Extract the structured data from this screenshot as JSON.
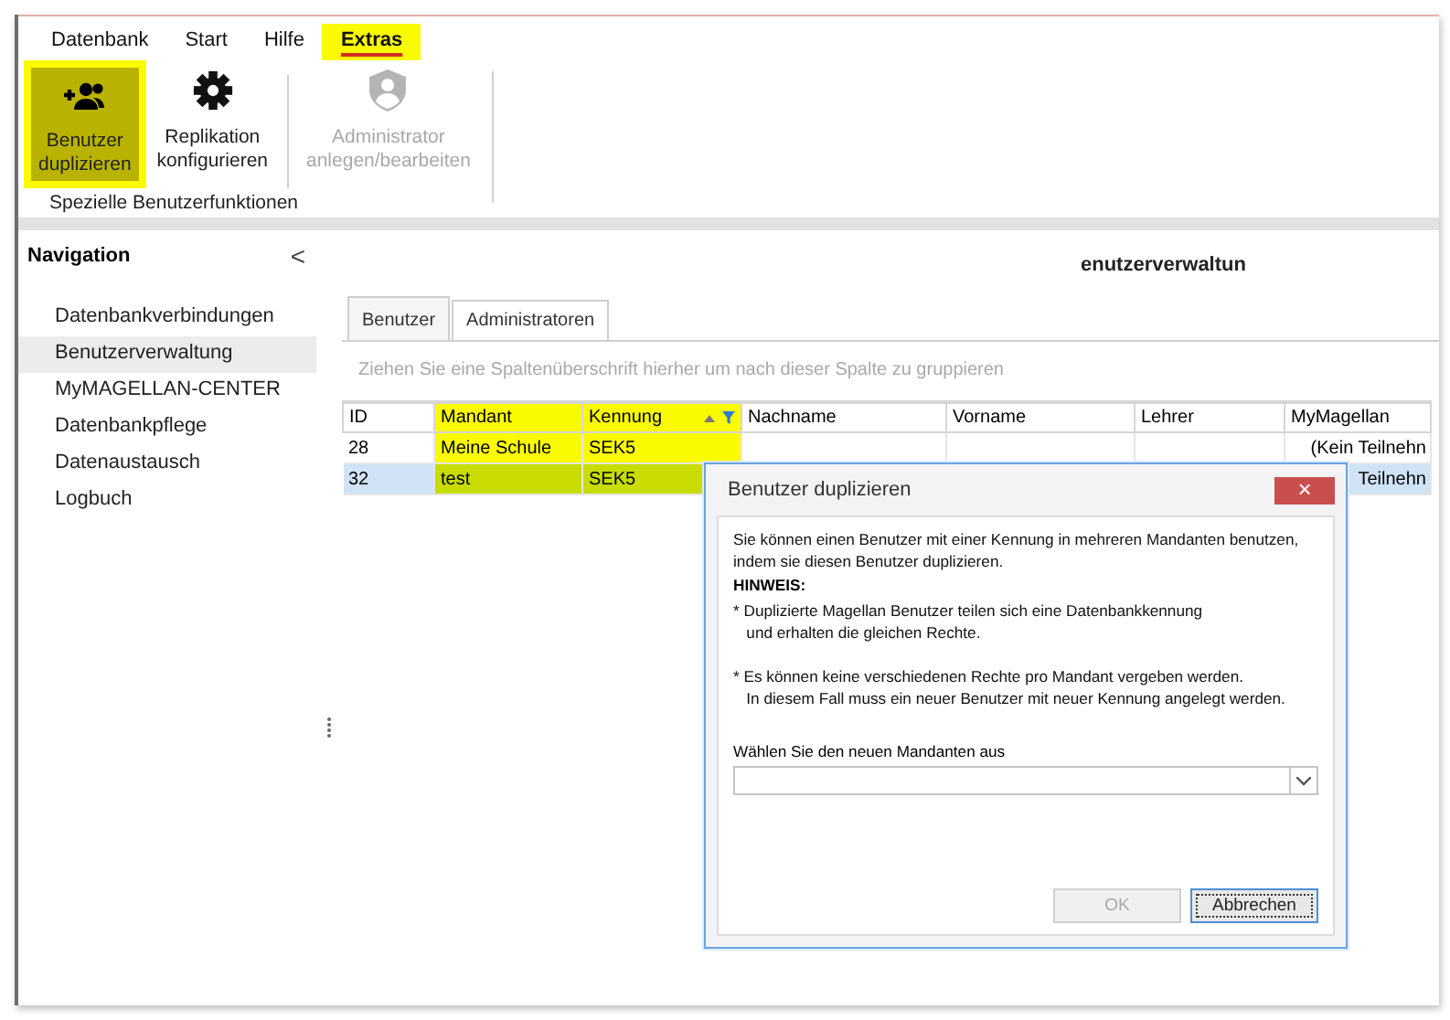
{
  "menu": [
    {
      "label": "Datenbank",
      "selected": false,
      "highlighted": false
    },
    {
      "label": "Start",
      "selected": false,
      "highlighted": false
    },
    {
      "label": "Hilfe",
      "selected": false,
      "highlighted": false
    },
    {
      "label": "Extras",
      "selected": true,
      "highlighted": true
    }
  ],
  "ribbon": {
    "groups": [
      {
        "label": "Spezielle Benutzerfunktionen",
        "buttons": [
          {
            "label": "Benutzer\nduplizieren",
            "disabled": false,
            "highlighted": true,
            "separator_after": false
          },
          {
            "label": "Replikation\nkonfigurieren",
            "disabled": false,
            "highlighted": false,
            "separator_after": true
          },
          {
            "label": "Administrator\nanlegen/bearbeiten",
            "disabled": true,
            "highlighted": false,
            "separator_after": false
          }
        ]
      }
    ]
  },
  "navigation": {
    "title": "Navigation",
    "collapse": "<",
    "items": [
      {
        "label": "Datenbankverbindungen",
        "selected": false
      },
      {
        "label": "Benutzerverwaltung",
        "selected": true
      },
      {
        "label": "MyMAGELLAN-CENTER",
        "selected": false
      },
      {
        "label": "Datenbankpflege",
        "selected": false
      },
      {
        "label": "Datenaustausch",
        "selected": false
      },
      {
        "label": "Logbuch",
        "selected": false
      }
    ]
  },
  "content": {
    "title": "enutzerverwaltun",
    "tabs": [
      {
        "label": "Benutzer",
        "selected": true
      },
      {
        "label": "Administratoren",
        "selected": false
      }
    ],
    "grid": {
      "group_hint": "Ziehen Sie eine Spaltenüberschrift hierher um nach dieser Spalte zu gruppieren",
      "columns": [
        {
          "label": "ID",
          "highlighted": false,
          "sorted": false,
          "filter": false
        },
        {
          "label": "Mandant",
          "highlighted": true,
          "sorted": false,
          "filter": false
        },
        {
          "label": "Kennung",
          "highlighted": true,
          "sorted": true,
          "filter": true
        },
        {
          "label": "Nachname",
          "highlighted": false,
          "sorted": false,
          "filter": false
        },
        {
          "label": "Vorname",
          "highlighted": false,
          "sorted": false,
          "filter": false
        },
        {
          "label": "Lehrer",
          "highlighted": false,
          "sorted": false,
          "filter": false
        },
        {
          "label": "MyMagellan",
          "highlighted": false,
          "sorted": false,
          "filter": false
        }
      ],
      "rows": [
        {
          "selected": false,
          "cells": [
            "28",
            "Meine Schule",
            "SEK5",
            null,
            null,
            null,
            "(Kein Teilnehn"
          ]
        },
        {
          "selected": true,
          "cells": [
            "32",
            "test",
            "SEK5",
            null,
            null,
            null,
            "Teilnehn"
          ]
        }
      ]
    }
  },
  "dialog": {
    "title": "Benutzer duplizieren",
    "close": "×",
    "intro": "Sie können einen Benutzer mit einer Kennung in mehreren Mandanten benutzen,\nindem sie diesen Benutzer duplizieren.",
    "note_heading": "HINWEIS:",
    "notes": [
      "* Duplizierte Magellan Benutzer teilen sich eine Datenbankkennung\n   und erhalten die gleichen Rechte.",
      "* Es können keine verschiedenen Rechte pro Mandant vergeben werden.\n   In diesem Fall muss ein neuer Benutzer mit neuer Kennung angelegt werden."
    ],
    "field_label": "Wählen Sie den neuen Mandanten aus",
    "buttons": [
      {
        "label": "OK",
        "disabled": true,
        "focused": false
      },
      {
        "label": "Abbrechen",
        "disabled": false,
        "focused": true
      }
    ]
  }
}
